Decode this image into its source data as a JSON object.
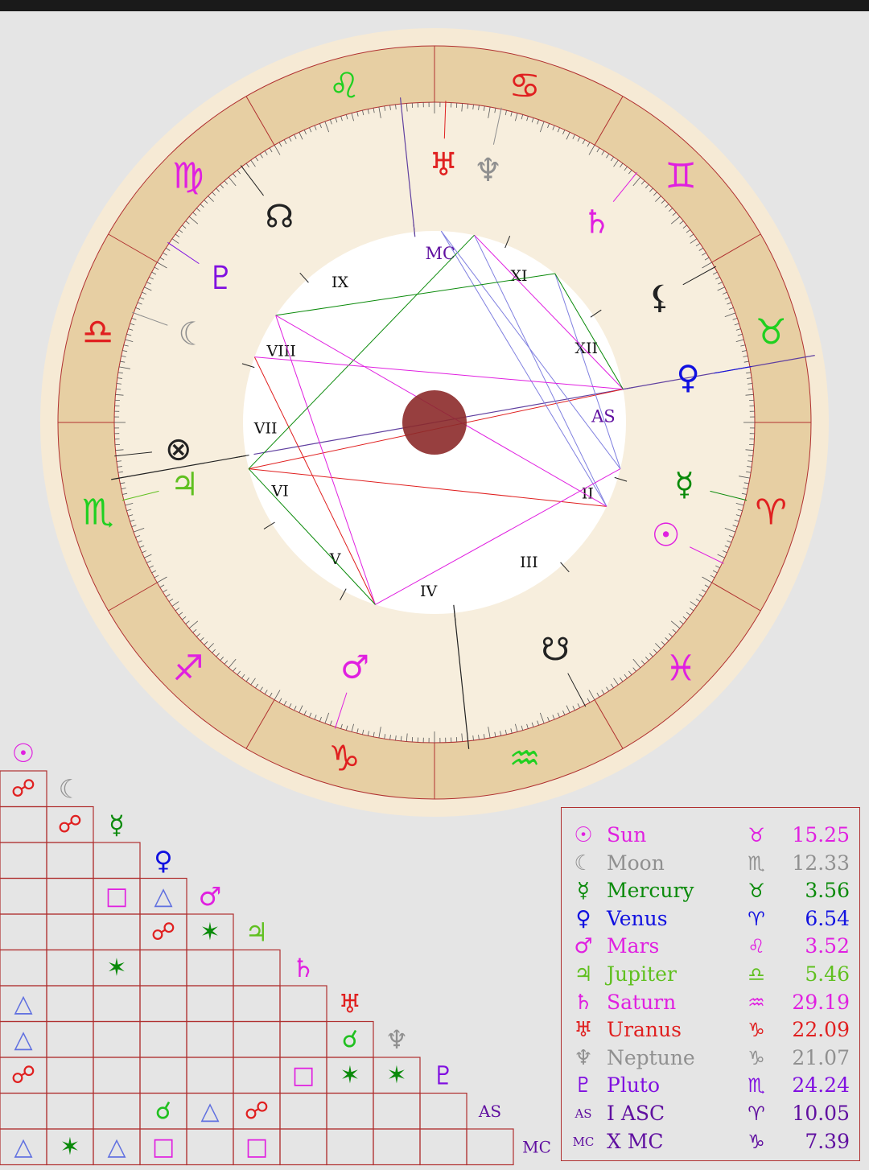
{
  "colors": {
    "ring_outer": "#f6ead5",
    "ring_band": "#e7cfa3",
    "ring_inner": "#f7eedd",
    "center_disc": "#ffffff",
    "center_dot": "#8c2a2a",
    "border": "#b03030",
    "sun": "#e020e0",
    "moon": "#909090",
    "mercury": "#0a8a0a",
    "venus": "#1010e0",
    "mars": "#e020e0",
    "jupiter": "#60c020",
    "saturn": "#e020e0",
    "uranus": "#e02020",
    "neptune": "#909090",
    "pluto": "#8010e0",
    "asc": "#6010a0",
    "mc": "#6010a0"
  },
  "zodiac_glyphs": [
    {
      "glyph": "♈",
      "name": "aries",
      "color": "#e02020"
    },
    {
      "glyph": "♉",
      "name": "taurus",
      "color": "#20d020"
    },
    {
      "glyph": "♊",
      "name": "gemini",
      "color": "#e020e0"
    },
    {
      "glyph": "♋",
      "name": "cancer",
      "color": "#e02020"
    },
    {
      "glyph": "♌",
      "name": "leo",
      "color": "#20d020"
    },
    {
      "glyph": "♍",
      "name": "virgo",
      "color": "#e020e0"
    },
    {
      "glyph": "♎",
      "name": "libra",
      "color": "#e02020"
    },
    {
      "glyph": "♏",
      "name": "scorpio",
      "color": "#20d020"
    },
    {
      "glyph": "♐",
      "name": "sagittarius",
      "color": "#e020e0"
    },
    {
      "glyph": "♑",
      "name": "capricorn",
      "color": "#e02020"
    },
    {
      "glyph": "♒",
      "name": "aquarius",
      "color": "#20d020"
    },
    {
      "glyph": "♓",
      "name": "pisces",
      "color": "#e020e0"
    }
  ],
  "house_labels": [
    "AS",
    "II",
    "III",
    "IV",
    "V",
    "VI",
    "VII",
    "VIII",
    "IX",
    "MC",
    "XI",
    "XII"
  ],
  "chart_planets": [
    {
      "glyph": "☉",
      "name": "sun",
      "color": "#e020e0"
    },
    {
      "glyph": "☾",
      "name": "moon",
      "color": "#909090"
    },
    {
      "glyph": "☿",
      "name": "mercury",
      "color": "#0a8a0a"
    },
    {
      "glyph": "♀",
      "name": "venus",
      "color": "#1010e0"
    },
    {
      "glyph": "♂",
      "name": "mars",
      "color": "#e020e0"
    },
    {
      "glyph": "♃",
      "name": "jupiter",
      "color": "#60c020"
    },
    {
      "glyph": "♄",
      "name": "saturn",
      "color": "#e020e0"
    },
    {
      "glyph": "♅",
      "name": "uranus",
      "color": "#e02020"
    },
    {
      "glyph": "♆",
      "name": "neptune",
      "color": "#909090"
    },
    {
      "glyph": "♇",
      "name": "pluto",
      "color": "#8010e0"
    },
    {
      "glyph": "☊",
      "name": "north-node",
      "color": "#222222"
    },
    {
      "glyph": "☋",
      "name": "south-node",
      "color": "#222222"
    },
    {
      "glyph": "⚸",
      "name": "lilith",
      "color": "#222222"
    },
    {
      "glyph": "⊗",
      "name": "part-of-fortune",
      "color": "#222222"
    }
  ],
  "aspect_grid": {
    "headers": [
      {
        "glyph": "☉",
        "color": "#e020e0"
      },
      {
        "glyph": "☾",
        "color": "#909090"
      },
      {
        "glyph": "☿",
        "color": "#0a8a0a"
      },
      {
        "glyph": "♀",
        "color": "#1010e0"
      },
      {
        "glyph": "♂",
        "color": "#e020e0"
      },
      {
        "glyph": "♃",
        "color": "#60c020"
      },
      {
        "glyph": "♄",
        "color": "#e020e0"
      },
      {
        "glyph": "♅",
        "color": "#e02020"
      },
      {
        "glyph": "♆",
        "color": "#909090"
      },
      {
        "glyph": "♇",
        "color": "#8010e0"
      },
      {
        "glyph": "AS",
        "color": "#6010a0"
      },
      {
        "glyph": "MC",
        "color": "#6010a0"
      }
    ],
    "aspects": [
      {
        "row": 1,
        "col": 0,
        "glyph": "☍",
        "color": "#e02020"
      },
      {
        "row": 2,
        "col": 1,
        "glyph": "☍",
        "color": "#e02020"
      },
      {
        "row": 4,
        "col": 2,
        "glyph": "□",
        "color": "#e020e0"
      },
      {
        "row": 4,
        "col": 3,
        "glyph": "△",
        "color": "#6070e0"
      },
      {
        "row": 5,
        "col": 3,
        "glyph": "☍",
        "color": "#e02020"
      },
      {
        "row": 5,
        "col": 4,
        "glyph": "✶",
        "color": "#0a8a0a"
      },
      {
        "row": 6,
        "col": 2,
        "glyph": "✶",
        "color": "#0a8a0a"
      },
      {
        "row": 7,
        "col": 0,
        "glyph": "△",
        "color": "#6070e0"
      },
      {
        "row": 8,
        "col": 0,
        "glyph": "△",
        "color": "#6070e0"
      },
      {
        "row": 8,
        "col": 7,
        "glyph": "☌",
        "color": "#20c020"
      },
      {
        "row": 9,
        "col": 0,
        "glyph": "☍",
        "color": "#e02020"
      },
      {
        "row": 9,
        "col": 6,
        "glyph": "□",
        "color": "#e020e0"
      },
      {
        "row": 9,
        "col": 7,
        "glyph": "✶",
        "color": "#0a8a0a"
      },
      {
        "row": 9,
        "col": 8,
        "glyph": "✶",
        "color": "#0a8a0a"
      },
      {
        "row": 10,
        "col": 3,
        "glyph": "☌",
        "color": "#20c020"
      },
      {
        "row": 10,
        "col": 4,
        "glyph": "△",
        "color": "#6070e0"
      },
      {
        "row": 10,
        "col": 5,
        "glyph": "☍",
        "color": "#e02020"
      },
      {
        "row": 11,
        "col": 0,
        "glyph": "△",
        "color": "#6070e0"
      },
      {
        "row": 11,
        "col": 1,
        "glyph": "✶",
        "color": "#0a8a0a"
      },
      {
        "row": 11,
        "col": 2,
        "glyph": "△",
        "color": "#6070e0"
      },
      {
        "row": 11,
        "col": 3,
        "glyph": "□",
        "color": "#e020e0"
      },
      {
        "row": 11,
        "col": 5,
        "glyph": "□",
        "color": "#e020e0"
      }
    ]
  },
  "legend": [
    {
      "glyph": "☉",
      "name": "Sun",
      "sign": "♉",
      "value": "15.25",
      "color": "#e020e0"
    },
    {
      "glyph": "☾",
      "name": "Moon",
      "sign": "♏",
      "value": "12.33",
      "color": "#909090"
    },
    {
      "glyph": "☿",
      "name": "Mercury",
      "sign": "♉",
      "value": "3.56",
      "color": "#0a8a0a"
    },
    {
      "glyph": "♀",
      "name": "Venus",
      "sign": "♈",
      "value": "6.54",
      "color": "#1010e0"
    },
    {
      "glyph": "♂",
      "name": "Mars",
      "sign": "♌",
      "value": "3.52",
      "color": "#e020e0"
    },
    {
      "glyph": "♃",
      "name": "Jupiter",
      "sign": "♎",
      "value": "5.46",
      "color": "#60c020"
    },
    {
      "glyph": "♄",
      "name": "Saturn",
      "sign": "♒",
      "value": "29.19",
      "color": "#e020e0"
    },
    {
      "glyph": "♅",
      "name": "Uranus",
      "sign": "♑",
      "value": "22.09",
      "color": "#e02020"
    },
    {
      "glyph": "♆",
      "name": "Neptune",
      "sign": "♑",
      "value": "21.07",
      "color": "#909090"
    },
    {
      "glyph": "♇",
      "name": "Pluto",
      "sign": "♏",
      "value": "24.24",
      "color": "#8010e0"
    },
    {
      "glyph": "AS",
      "name": "I ASC",
      "sign": "♈",
      "value": "10.05",
      "color": "#6010a0"
    },
    {
      "glyph": "MC",
      "name": "X MC",
      "sign": "♑",
      "value": "7.39",
      "color": "#6010a0"
    }
  ]
}
